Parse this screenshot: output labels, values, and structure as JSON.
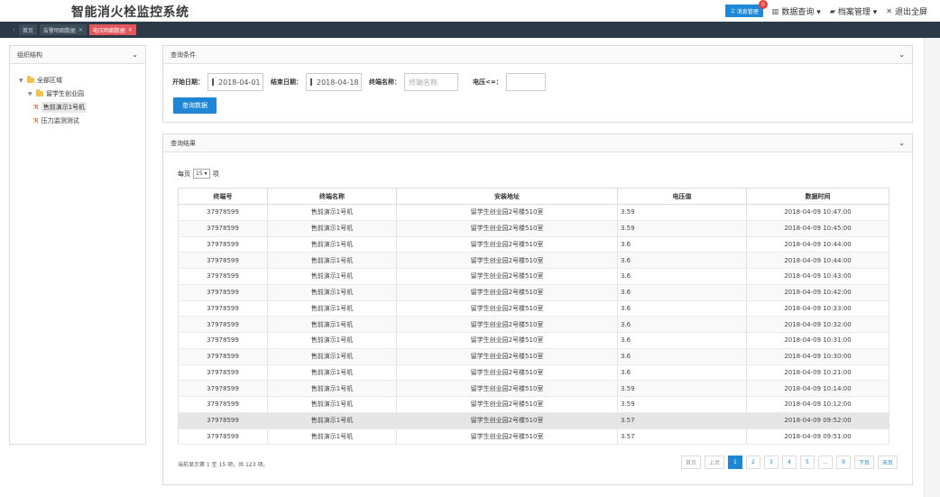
{
  "app": {
    "title": "智能消火栓监控系统"
  },
  "header": {
    "message_label": "消息管理",
    "message_count": "0",
    "data_query": "数据查询 ▾",
    "archive_manage": "档案管理 ▾",
    "exit_fullscreen": "退出全屏"
  },
  "tabs": [
    {
      "label": "首页"
    },
    {
      "label": "告警明细数据"
    },
    {
      "label": "电压明细数据"
    }
  ],
  "left": {
    "title": "组织结构",
    "tree": [
      {
        "label": "全部区域"
      },
      {
        "label": "留学生创业园"
      },
      {
        "label": "售前演示1号机"
      },
      {
        "label": "压力监测测试"
      }
    ]
  },
  "query": {
    "title": "查询条件",
    "start_label": "开始日期：",
    "start_value": "2018-04-01",
    "end_label": "结束日期：",
    "end_value": "2018-04-18",
    "terminal_label": "终端名称：",
    "terminal_placeholder": "终端名称",
    "voltage_label": "电压<=：",
    "voltage_value": "",
    "submit": "查询数据"
  },
  "results": {
    "title": "查询结果",
    "per_page_prefix": "每页",
    "per_page_value": "15",
    "per_page_suffix": "项",
    "columns": [
      "终端号",
      "终端名称",
      "安装地址",
      "电压值",
      "数据时间"
    ],
    "rows": [
      [
        "37978599",
        "售前演示1号机",
        "留学生创业园2号楼510室",
        "3.59",
        "2018-04-09 10:47:00"
      ],
      [
        "37978599",
        "售前演示1号机",
        "留学生创业园2号楼510室",
        "3.59",
        "2018-04-09 10:45:00"
      ],
      [
        "37978599",
        "售前演示1号机",
        "留学生创业园2号楼510室",
        "3.6",
        "2018-04-09 10:44:00"
      ],
      [
        "37978599",
        "售前演示1号机",
        "留学生创业园2号楼510室",
        "3.6",
        "2018-04-09 10:44:00"
      ],
      [
        "37978599",
        "售前演示1号机",
        "留学生创业园2号楼510室",
        "3.6",
        "2018-04-09 10:43:00"
      ],
      [
        "37978599",
        "售前演示1号机",
        "留学生创业园2号楼510室",
        "3.6",
        "2018-04-09 10:42:00"
      ],
      [
        "37978599",
        "售前演示1号机",
        "留学生创业园2号楼510室",
        "3.6",
        "2018-04-09 10:33:00"
      ],
      [
        "37978599",
        "售前演示1号机",
        "留学生创业园2号楼510室",
        "3.6",
        "2018-04-09 10:32:00"
      ],
      [
        "37978599",
        "售前演示1号机",
        "留学生创业园2号楼510室",
        "3.6",
        "2018-04-09 10:31:00"
      ],
      [
        "37978599",
        "售前演示1号机",
        "留学生创业园2号楼510室",
        "3.6",
        "2018-04-09 10:30:00"
      ],
      [
        "37978599",
        "售前演示1号机",
        "留学生创业园2号楼510室",
        "3.6",
        "2018-04-09 10:21:00"
      ],
      [
        "37978599",
        "售前演示1号机",
        "留学生创业园2号楼510室",
        "3.59",
        "2018-04-09 10:14:00"
      ],
      [
        "37978599",
        "售前演示1号机",
        "留学生创业园2号楼510室",
        "3.59",
        "2018-04-09 10:12:00"
      ],
      [
        "37978599",
        "售前演示1号机",
        "留学生创业园2号楼510室",
        "3.57",
        "2018-04-09 09:52:00"
      ],
      [
        "37978599",
        "售前演示1号机",
        "留学生创业园2号楼510室",
        "3.57",
        "2018-04-09 09:51:00"
      ]
    ],
    "summary": "当前显示第 1 至 15 项，共 123 项。",
    "pagination": [
      "首页",
      "上页",
      "1",
      "2",
      "3",
      "4",
      "5",
      "...",
      "9",
      "下页",
      "末页"
    ]
  },
  "colors": {
    "primary": "#1f86d6",
    "tab_active": "#e4575a",
    "tabbar": "#2c3a47"
  }
}
